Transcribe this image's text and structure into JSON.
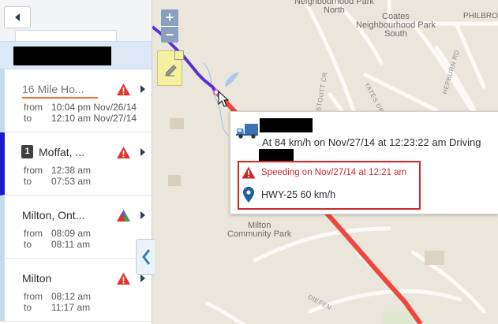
{
  "sidebar": {
    "back_icon": "chevron-left-icon",
    "collapse_icon": "chevron-left-icon",
    "trips": [
      {
        "title": "16 Mile Ho...",
        "from_label": "from",
        "from_time": "10:04 pm Nov/26/14",
        "to_label": "to",
        "to_time": "12:10 am Nov/27/14",
        "warning_color": "#e0332c"
      },
      {
        "number": "1",
        "title": "Moffat, ...",
        "from_label": "from",
        "from_time": "12:38 am",
        "to_label": "to",
        "to_time": "07:53 am",
        "warning_color": "#e0332c"
      },
      {
        "title": "Milton, Ont...",
        "from_label": "from",
        "from_time": "08:09 am",
        "to_label": "to",
        "to_time": "08:11 am",
        "warning_color": "#3aa54a"
      },
      {
        "title": "Milton",
        "from_label": "from",
        "from_time": "08:12 am",
        "to_label": "to",
        "to_time": "11:17 am",
        "warning_color": "#e0332c"
      }
    ]
  },
  "map": {
    "zoom_in_label": "+",
    "zoom_out_label": "−",
    "labels": {
      "neighbourhood_north_1": "Neighbourhood Park",
      "neighbourhood_north_2": "North",
      "neighbourhood_south_1": "Coates",
      "neighbourhood_south_2": "Neighbourhood Park",
      "neighbourhood_south_3": "South",
      "philbrook": "PHILBROO",
      "hepburn": "HEPBURN RD",
      "stoutt": "STOUTT CR",
      "yates": "YATES DR",
      "milton_park_1": "Milton",
      "milton_park_2": "Community Park",
      "diefen": "DIEFEN"
    },
    "colors": {
      "route_red": "#f0463f",
      "route_blue": "#5b2fd6",
      "water": "#a9c8e8"
    }
  },
  "popup": {
    "vehicle_icon": "truck-icon",
    "status": "At 84 km/h on Nov/27/14 at 12:23:22 am Driving",
    "exception": {
      "icon": "warning-icon",
      "text": "Speeding on Nov/27/14 at 12:21 am",
      "color": "#d0262a"
    },
    "location": {
      "icon": "map-pin-icon",
      "text": "HWY-25 60 km/h"
    }
  }
}
